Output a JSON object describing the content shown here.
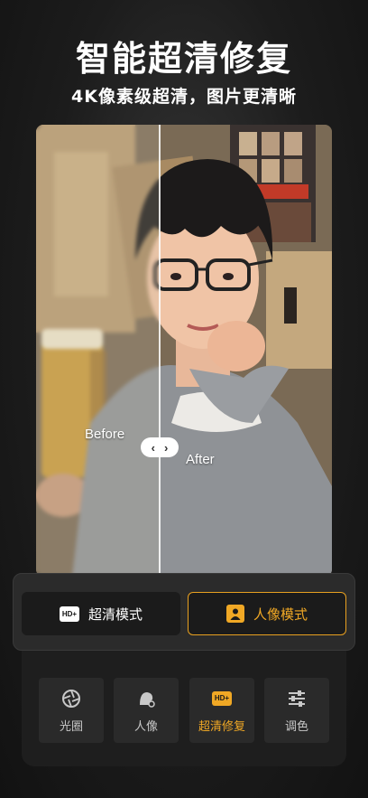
{
  "header": {
    "title": "智能超清修复",
    "subtitle": "4K像素级超清，图片更清晰"
  },
  "comparison": {
    "before_label": "Before",
    "after_label": "After",
    "handle_left": "‹",
    "handle_right": "›"
  },
  "modes": {
    "hd_label": "超清模式",
    "hd_badge": "HD+",
    "portrait_label": "人像模式",
    "selected": "人像模式"
  },
  "tools": [
    {
      "label": "光圈",
      "icon": "aperture-icon"
    },
    {
      "label": "人像",
      "icon": "portrait-icon"
    },
    {
      "label": "超清修复",
      "icon": "hd-plus-icon",
      "badge": "HD+"
    },
    {
      "label": "调色",
      "icon": "sliders-icon"
    }
  ],
  "colors": {
    "accent": "#f0a825",
    "panel": "#2b2b2b",
    "background": "#1c1c1c"
  }
}
